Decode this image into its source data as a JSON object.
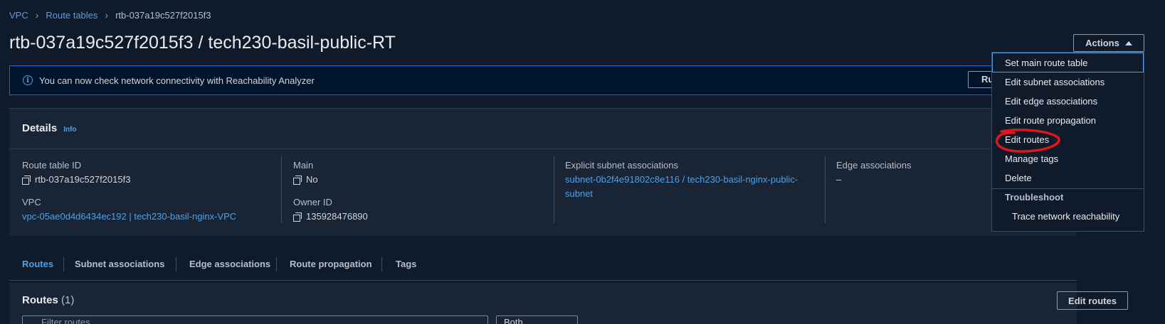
{
  "breadcrumb": {
    "items": [
      "VPC",
      "Route tables"
    ],
    "current": "rtb-037a19c527f2015f3"
  },
  "page_title": "rtb-037a19c527f2015f3 / tech230-basil-public-RT",
  "actions_label": "Actions",
  "banner": {
    "text": "You can now check network connectivity with Reachability Analyzer",
    "button_label": "Run Reachability Analyzer"
  },
  "details": {
    "heading": "Details",
    "info": "Info",
    "route_table_id_label": "Route table ID",
    "route_table_id": "rtb-037a19c527f2015f3",
    "vpc_label": "VPC",
    "vpc": "vpc-05ae0d4d6434ec192 | tech230-basil-nginx-VPC",
    "main_label": "Main",
    "main": "No",
    "owner_label": "Owner ID",
    "owner": "135928476890",
    "explicit_label": "Explicit subnet associations",
    "explicit_line1": "subnet-0b2f4e91802c8e116 / tech230-basil-nginx-public-",
    "explicit_line2": "subnet",
    "edge_label": "Edge associations",
    "edge": "–"
  },
  "tabs": [
    "Routes",
    "Subnet associations",
    "Edge associations",
    "Route propagation",
    "Tags"
  ],
  "routes": {
    "title": "Routes",
    "count": "(1)",
    "edit_button": "Edit routes",
    "filter_placeholder": "Filter routes",
    "select_value": "Both"
  },
  "actions_menu": {
    "items": [
      "Set main route table",
      "Edit subnet associations",
      "Edit edge associations",
      "Edit route propagation",
      "Edit routes",
      "Manage tags",
      "Delete"
    ],
    "group": "Troubleshoot",
    "group_items": [
      "Trace network reachability"
    ]
  },
  "colors": {
    "link": "#539fe5",
    "annotation": "#e0161b",
    "background": "#0f1b2a"
  }
}
